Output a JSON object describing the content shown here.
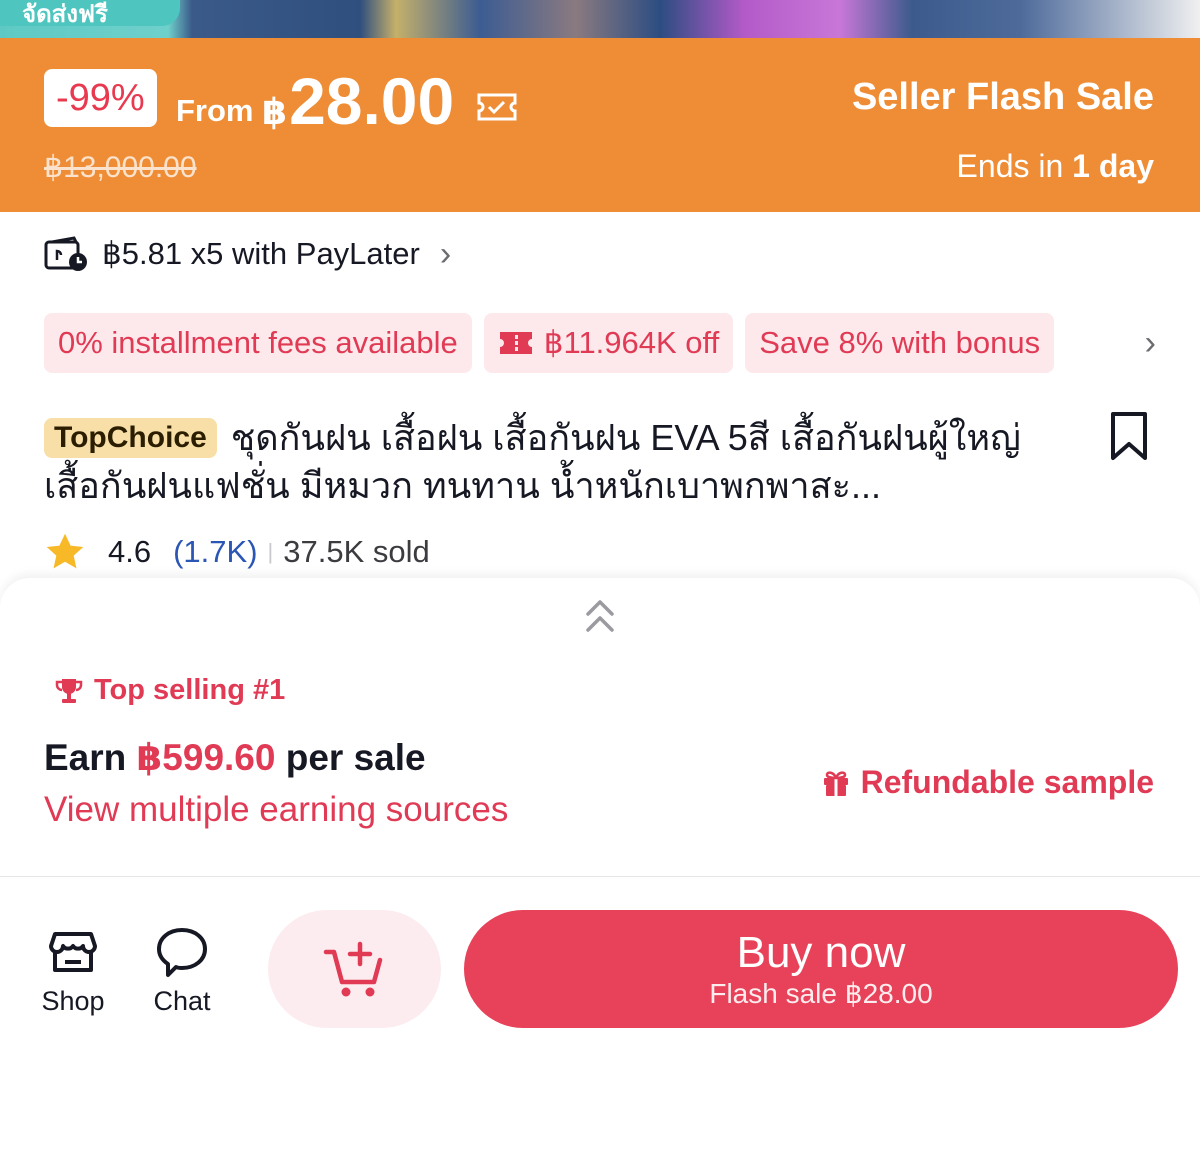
{
  "image_strip": {
    "promo_tag": "จัดส่งฟรี"
  },
  "flash_sale": {
    "discount": "-99%",
    "from_label": "From",
    "currency": "฿",
    "price": "28.00",
    "original_price": "฿13,000.00",
    "title": "Seller Flash Sale",
    "ends_prefix": "Ends in",
    "ends_value": "1 day",
    "colors": {
      "banner": "#ee8d35",
      "badge_text": "#e8394f"
    }
  },
  "paylater": {
    "text": "฿5.81 x5 with PayLater",
    "icon": "paylater-icon"
  },
  "promo_chips": [
    {
      "label": "0% installment fees available"
    },
    {
      "label": "฿11.964K off",
      "icon": "ticket-icon"
    },
    {
      "label": "Save 8% with bonus"
    }
  ],
  "product": {
    "badge": "TopChoice",
    "title": "ชุดกันฝน เสื้อฝน เสื้อกันฝน EVA 5สี เสื้อกันฝนผู้ใหญ่ เสื้อกันฝนแฟชั่น มีหมวก ทนทาน น้ำหนักเบาพกพาสะ...",
    "rating": "4.6",
    "rating_count": "(1.7K)",
    "sold": "37.5K sold"
  },
  "sheet": {
    "top_selling": "Top selling #1",
    "earn_prefix": "Earn",
    "earn_amount": "฿599.60",
    "earn_suffix": "per sale",
    "view_multiple": "View multiple earning sources",
    "refundable": "Refundable sample"
  },
  "bottom_bar": {
    "shop_label": "Shop",
    "chat_label": "Chat",
    "buy_label": "Buy now",
    "buy_sub": "Flash sale ฿28.00",
    "colors": {
      "buy": "#e8425a",
      "accent": "#e03a55"
    }
  }
}
